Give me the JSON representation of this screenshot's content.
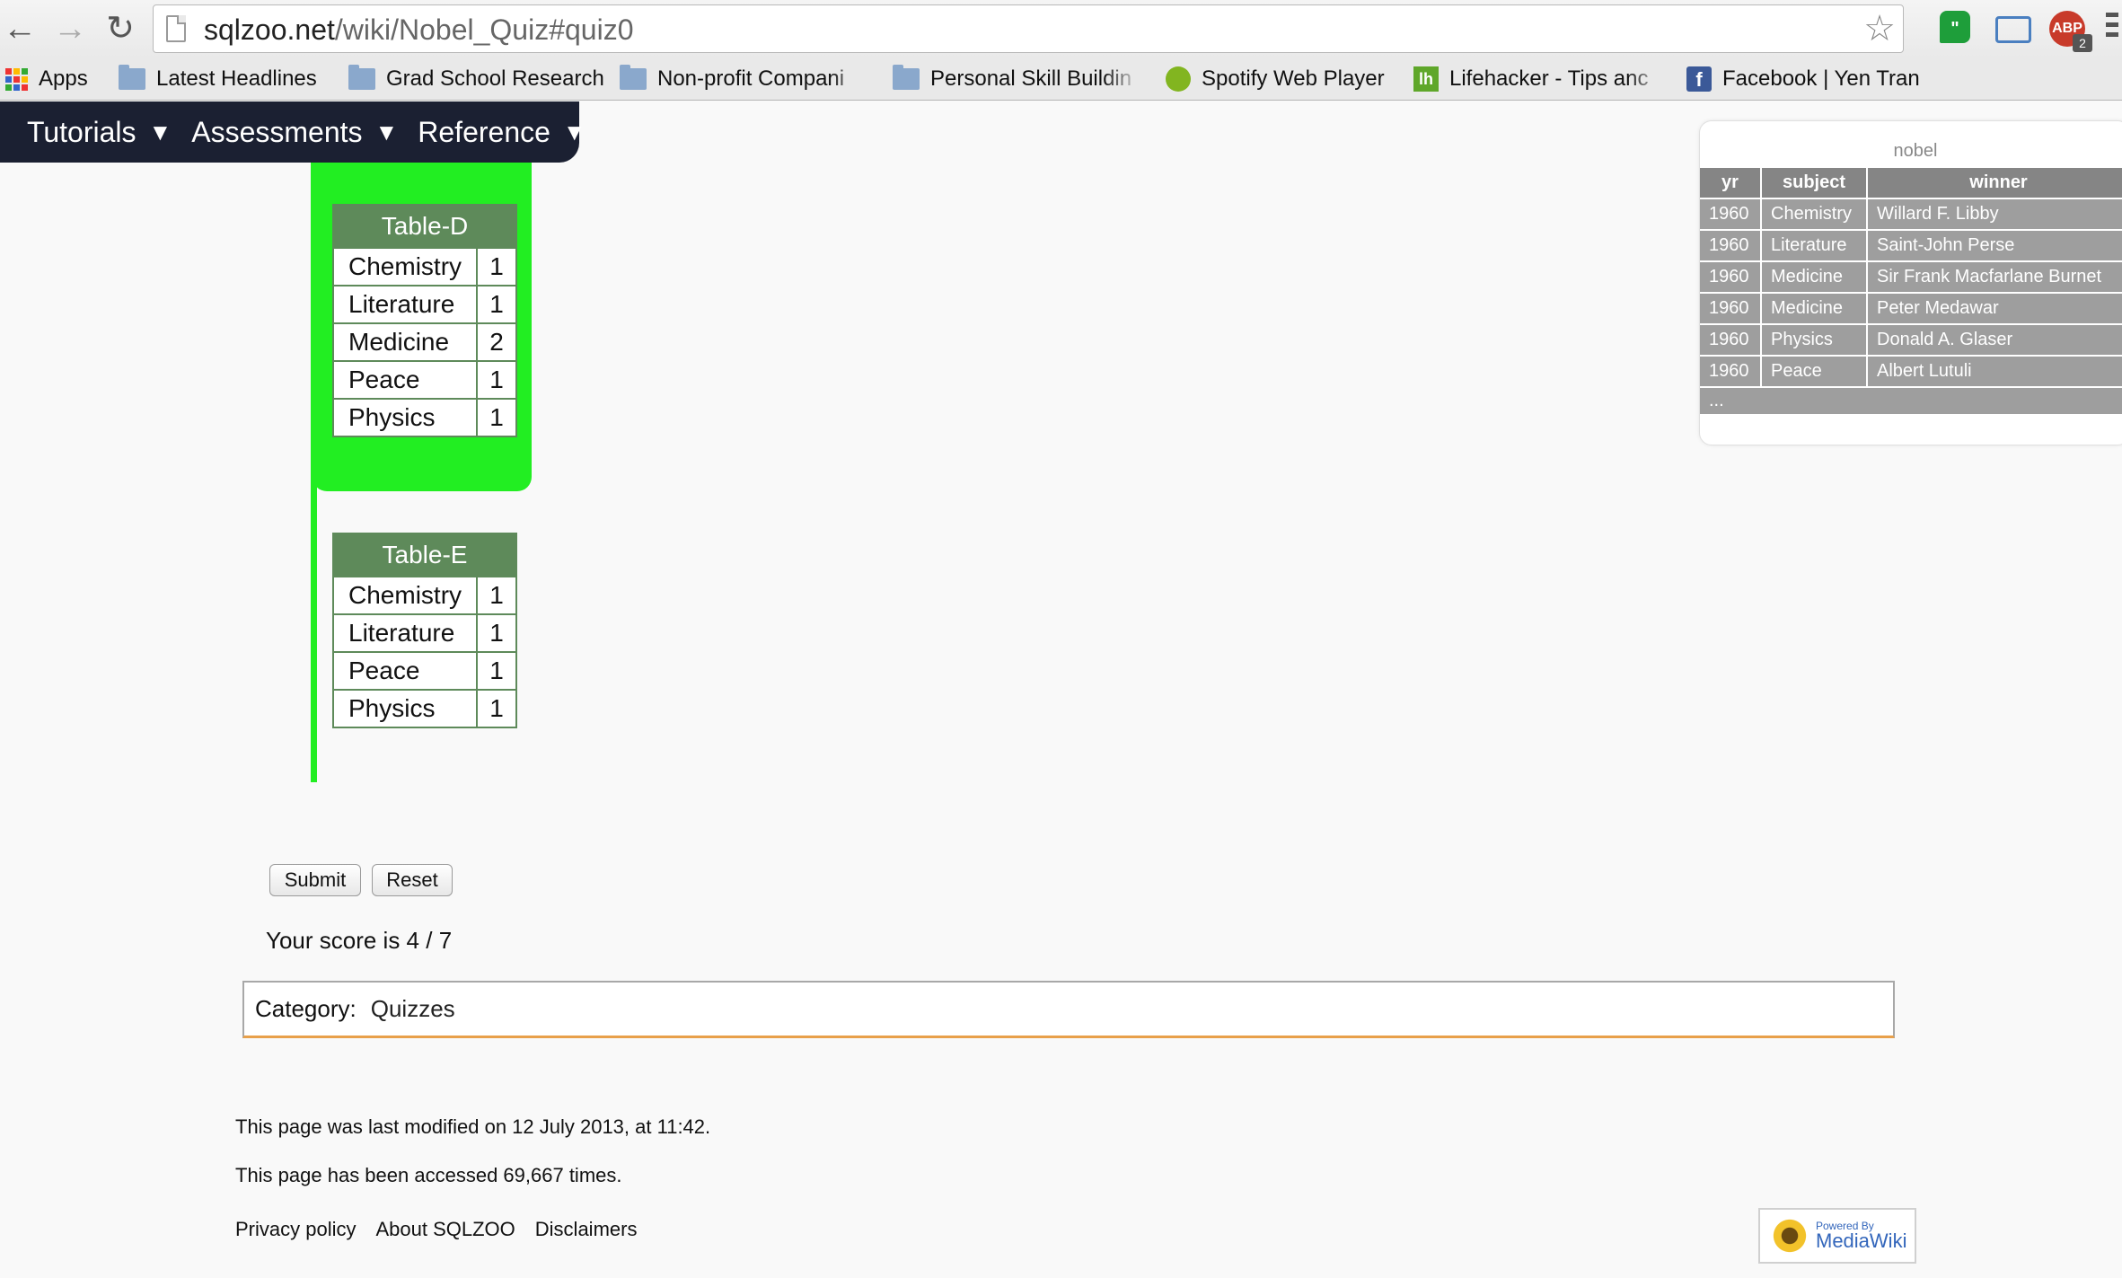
{
  "browser": {
    "url_host": "sqlzoo.net",
    "url_path": "/wiki/Nobel_Quiz#quiz0",
    "abp_label": "ABP",
    "abp_count": "2"
  },
  "bookmarks": [
    {
      "label": "Apps",
      "icon": "apps-icon"
    },
    {
      "label": "Latest Headlines",
      "icon": "folder-icon"
    },
    {
      "label": "Grad School Research",
      "icon": "folder-icon"
    },
    {
      "label": "Non-profit Compani",
      "icon": "folder-icon"
    },
    {
      "label": "Personal Skill Buildin",
      "icon": "folder-icon"
    },
    {
      "label": "Spotify Web Player",
      "icon": "spotify-icon"
    },
    {
      "label": "Lifehacker - Tips anc",
      "icon": "lifehacker-icon"
    },
    {
      "label": "Facebook | Yen Tran",
      "icon": "facebook-icon"
    }
  ],
  "site_nav": {
    "items": [
      {
        "label": "Tutorials"
      },
      {
        "label": "Assessments"
      },
      {
        "label": "Reference"
      }
    ]
  },
  "quiz": {
    "table_d": {
      "title": "Table-D",
      "rows": [
        {
          "subject": "Chemistry",
          "count": "1"
        },
        {
          "subject": "Literature",
          "count": "1"
        },
        {
          "subject": "Medicine",
          "count": "2"
        },
        {
          "subject": "Peace",
          "count": "1"
        },
        {
          "subject": "Physics",
          "count": "1"
        }
      ]
    },
    "table_e": {
      "title": "Table-E",
      "rows": [
        {
          "subject": "Chemistry",
          "count": "1"
        },
        {
          "subject": "Literature",
          "count": "1"
        },
        {
          "subject": "Peace",
          "count": "1"
        },
        {
          "subject": "Physics",
          "count": "1"
        }
      ]
    },
    "submit_label": "Submit",
    "reset_label": "Reset",
    "score_text": "Your score is 4 / 7"
  },
  "category": {
    "label": "Category:",
    "value": "Quizzes"
  },
  "footer": {
    "modified": "This page was last modified on 12 July 2013, at 11:42.",
    "accessed": "This page has been accessed 69,667 times.",
    "links": [
      "Privacy policy",
      "About SQLZOO",
      "Disclaimers"
    ],
    "badge_small": "Powered By",
    "badge_big": "MediaWiki"
  },
  "reference": {
    "caption": "nobel",
    "columns": [
      "yr",
      "subject",
      "winner"
    ],
    "rows": [
      [
        "1960",
        "Chemistry",
        "Willard F. Libby"
      ],
      [
        "1960",
        "Literature",
        "Saint-John Perse"
      ],
      [
        "1960",
        "Medicine",
        "Sir Frank Macfarlane Burnet"
      ],
      [
        "1960",
        "Medicine",
        "Peter Medawar"
      ],
      [
        "1960",
        "Physics",
        "Donald A. Glaser"
      ],
      [
        "1960",
        "Peace",
        "Albert Lutuli"
      ]
    ],
    "more": "..."
  },
  "colors": {
    "selected_answer": "#22ee22",
    "table_header": "#5e8a5a",
    "nav_bg": "#1b2032"
  }
}
